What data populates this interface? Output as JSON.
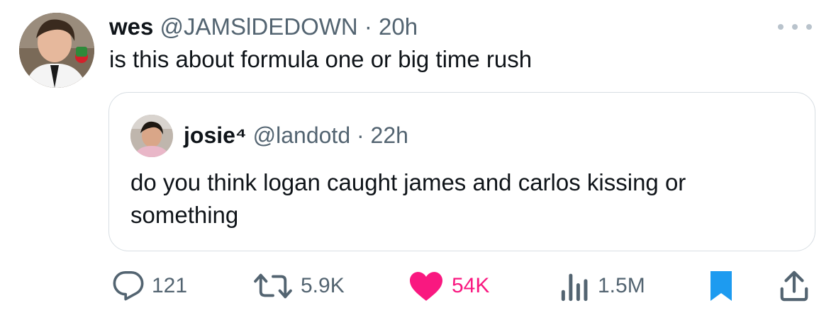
{
  "tweet": {
    "author_name": "wes",
    "author_handle": "@JAMSlDEDOWN",
    "time": "20h",
    "text": "is this about formula one or big time rush"
  },
  "quoted_tweet": {
    "author_name": "josie⁴",
    "author_handle": "@landotd",
    "time": "22h",
    "text": "do you think logan caught james and carlos kissing or something"
  },
  "actions": {
    "replies": "121",
    "retweets": "5.9K",
    "likes": "54K",
    "views": "1.5M"
  },
  "separator": " · ",
  "colors": {
    "like": "#f91880",
    "bookmark": "#1d9bf0",
    "secondary_text": "#536471",
    "border": "#d8dee3"
  },
  "icons": [
    "more-icon",
    "reply-icon",
    "retweet-icon",
    "heart-icon",
    "views-icon",
    "bookmark-icon",
    "share-icon"
  ]
}
